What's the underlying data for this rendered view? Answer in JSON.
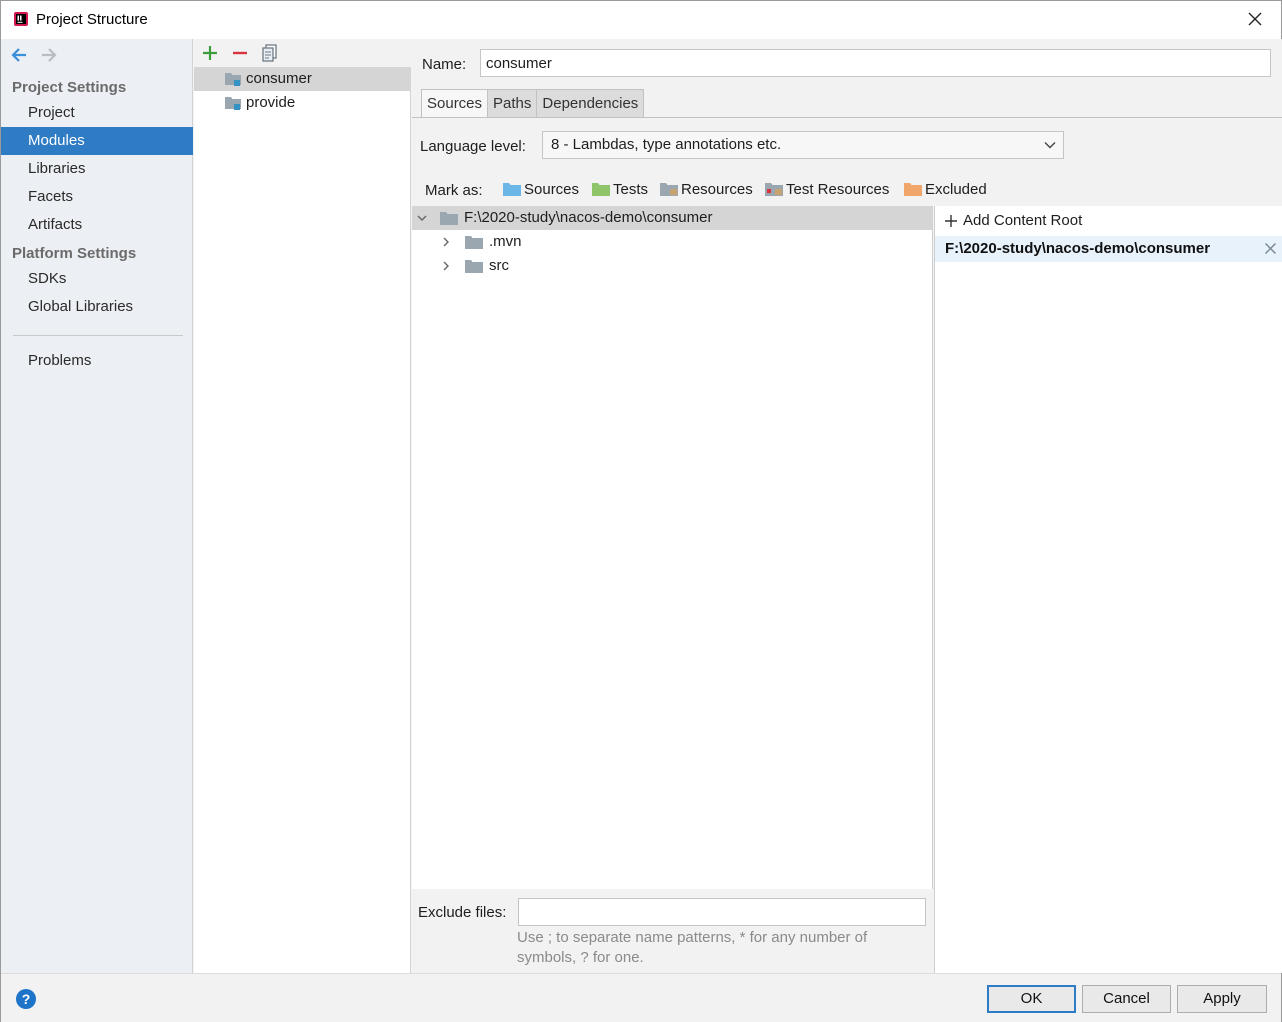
{
  "window": {
    "title": "Project Structure"
  },
  "sidebar": {
    "project_settings_title": "Project Settings",
    "project_settings_items": [
      {
        "label": "Project",
        "selected": false
      },
      {
        "label": "Modules",
        "selected": true
      },
      {
        "label": "Libraries",
        "selected": false
      },
      {
        "label": "Facets",
        "selected": false
      },
      {
        "label": "Artifacts",
        "selected": false
      }
    ],
    "platform_settings_title": "Platform Settings",
    "platform_settings_items": [
      {
        "label": "SDKs"
      },
      {
        "label": "Global Libraries"
      }
    ],
    "problems_label": "Problems"
  },
  "modules": {
    "items": [
      {
        "label": "consumer",
        "selected": true
      },
      {
        "label": "provide",
        "selected": false
      }
    ]
  },
  "details": {
    "name_label": "Name:",
    "name_value": "consumer",
    "tabs": [
      {
        "label": "Sources",
        "active": true
      },
      {
        "label": "Paths",
        "active": false
      },
      {
        "label": "Dependencies",
        "active": false
      }
    ],
    "language_level_label": "Language level:",
    "language_level_value": "8 - Lambdas, type annotations etc.",
    "mark_as_label": "Mark as:",
    "mark_as_options": [
      {
        "label": "Sources",
        "color": "#6ab7e7",
        "icon": "sources-folder-icon"
      },
      {
        "label": "Tests",
        "color": "#8fc46b",
        "icon": "tests-folder-icon"
      },
      {
        "label": "Resources",
        "color": "#9aa7b1",
        "icon": "resources-folder-icon"
      },
      {
        "label": "Test Resources",
        "color": "#9aa7b1",
        "icon": "test-resources-folder-icon"
      },
      {
        "label": "Excluded",
        "color": "#f0a56a",
        "icon": "excluded-folder-icon"
      }
    ],
    "tree": {
      "root": "F:\\2020-study\\nacos-demo\\consumer",
      "children": [
        ".mvn",
        "src"
      ]
    },
    "content_roots": {
      "add_label": "Add Content Root",
      "roots": [
        "F:\\2020-study\\nacos-demo\\consumer"
      ]
    },
    "exclude_files_label": "Exclude files:",
    "exclude_files_value": "",
    "exclude_hint": "Use ; to separate name patterns, * for any number of symbols, ? for one."
  },
  "footer": {
    "help_label": "?",
    "ok_label": "OK",
    "cancel_label": "Cancel",
    "apply_label": "Apply"
  },
  "colors": {
    "selection_blue": "#2f7cc4",
    "sidebar_bg": "#eceff3",
    "folder_gray": "#9aa7b1"
  }
}
